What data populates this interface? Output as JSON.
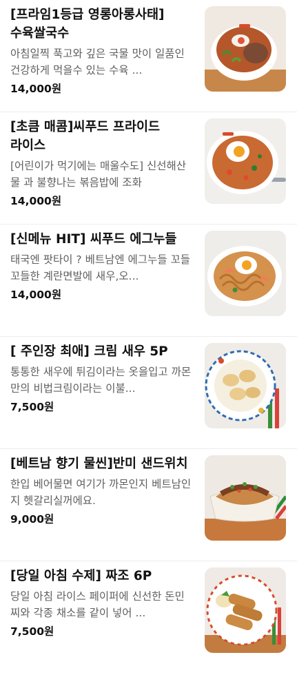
{
  "currency_suffix": "원",
  "menu_items": [
    {
      "name": "[프라임1등급 영롱아롱사태]수육쌀국수",
      "description": "아침일찍 푹고와 깊은 국물 맛이 일품인 건강하게 먹을수 있는 수육 ...",
      "price": "14,000원",
      "image_icon": "pho-bowl-icon"
    },
    {
      "name": "[초큼 매콤]씨푸드 프라이드 라이스",
      "description": "[어린이가 먹기에는 매울수도] 신선해산물 과 불향나는 볶음밥에 조화",
      "price": "14,000원",
      "image_icon": "fried-rice-plate-icon"
    },
    {
      "name": "[신메뉴 HIT] 씨푸드 에그누들",
      "description": "태국엔 팟타이 ? 베트남엔 에그누들 꼬들 꼬들한 계란면발에 새우,오...",
      "price": "14,000원",
      "image_icon": "egg-noodle-plate-icon"
    },
    {
      "name": "[ 주인장 최애] 크림 새우 5P",
      "description": "통통한 새우에 튀김이라는 옷을입고 까몬 만의 비법크림이라는 이불...",
      "price": "7,500원",
      "image_icon": "cream-shrimp-plate-icon"
    },
    {
      "name": "[베트남 향기 물씬]반미 샌드위치",
      "description": "한입 베어물면 여기가 까몬인지 베트남인지 헷갈리실꺼에요.",
      "price": "9,000원",
      "image_icon": "banh-mi-sandwich-icon"
    },
    {
      "name": "[당일 아침 수제] 짜조 6P",
      "description": "당일 아침 라이스 페이퍼에 신선한 돈민찌와 각종 채소를 같이 넣어 ...",
      "price": "7,500원",
      "image_icon": "spring-roll-plate-icon"
    }
  ]
}
